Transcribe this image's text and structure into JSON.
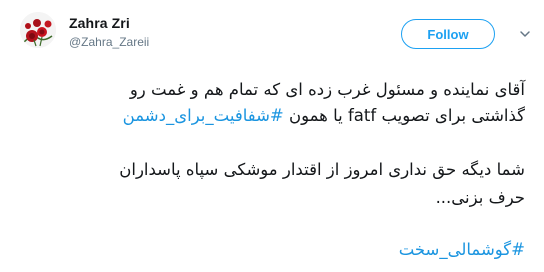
{
  "user": {
    "name": "Zahra Zri",
    "handle": "@Zahra_Zareii",
    "avatar_icon": "roses-avatar-icon"
  },
  "follow_button": {
    "label": "Follow",
    "color": "#1da1f2"
  },
  "menu": {
    "icon": "chevron-down-icon"
  },
  "tweet": {
    "line1": "آقای نماینده و مسئول غرب زده ای که تمام هم و غمت رو",
    "line2_part1": "گذاشتی برای تصویب",
    "line2_fatf": "fatf",
    "line2_part2": "یا همون",
    "hashtag1": "#شفافیت_برای_دشمن",
    "line3": "شما دیگه حق نداری امروز از اقتدار موشکی سپاه پاسداران",
    "line4": "حرف بزنی...",
    "hashtag2": "#گوشمالی_سخت"
  },
  "colors": {
    "text": "#14171a",
    "secondary": "#657786",
    "link": "#1b95e0"
  }
}
